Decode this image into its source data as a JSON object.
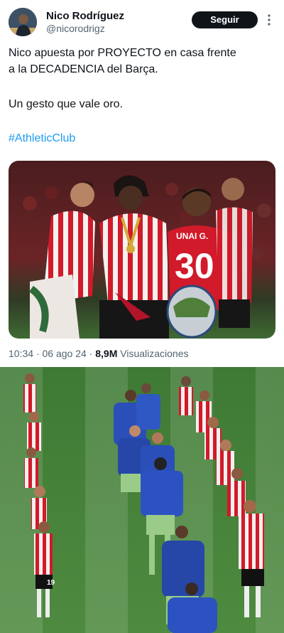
{
  "user": {
    "name": "Nico Rodríguez",
    "handle": "@nicorodrigz",
    "follow_label": "Seguir"
  },
  "tweet": {
    "line1": "Nico apuesta por PROYECTO en casa frente",
    "line2": "a la DECADENCIA del Barça.",
    "line3": "Un gesto que vale oro.",
    "hashtag": "#AthleticClub"
  },
  "photo1": {
    "jersey_name": "UNAI G.",
    "jersey_number": "30"
  },
  "photo2": {
    "jersey_number": "19"
  },
  "meta": {
    "time": "10:34",
    "sep": " · ",
    "date": "06 ago 24",
    "sep2": " · ",
    "views_count": "8,9M",
    "views_label": " Visualizaciones"
  },
  "colors": {
    "accent": "#1d9bf0",
    "button": "#0f1419",
    "muted": "#536471"
  }
}
